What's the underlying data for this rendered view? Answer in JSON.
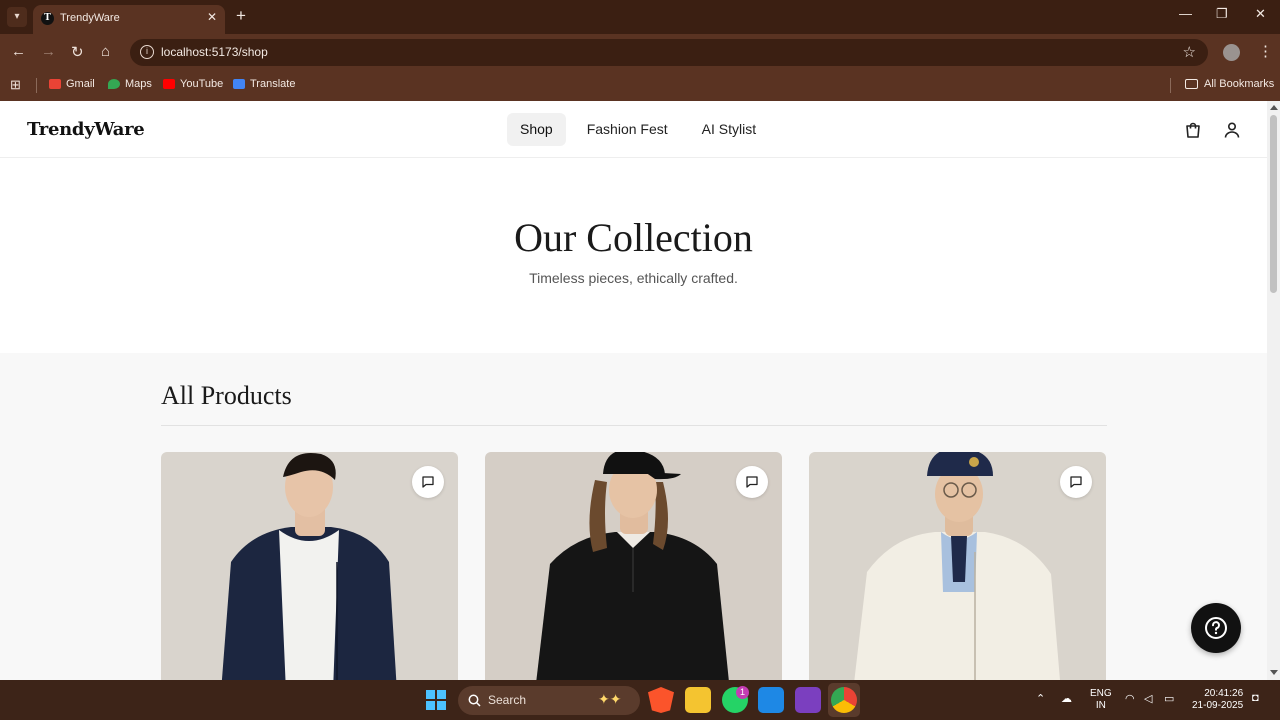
{
  "browser": {
    "tab_title": "TrendyWare",
    "tab_favicon": "T",
    "url": "localhost:5173/shop",
    "bookmarks": [
      {
        "label": "Gmail",
        "color": "#ea4335"
      },
      {
        "label": "Maps",
        "color": "#34a853"
      },
      {
        "label": "YouTube",
        "color": "#ff0000"
      },
      {
        "label": "Translate",
        "color": "#4285f4"
      }
    ],
    "all_bookmarks": "All Bookmarks"
  },
  "site": {
    "logo": "TrendyWare",
    "nav": [
      {
        "label": "Shop",
        "active": true
      },
      {
        "label": "Fashion Fest",
        "active": false
      },
      {
        "label": "AI Stylist",
        "active": false
      }
    ],
    "icons": [
      "shopping-bag-icon",
      "user-icon"
    ]
  },
  "hero": {
    "title": "Our Collection",
    "subtitle": "Timeless pieces, ethically crafted."
  },
  "products": {
    "heading": "All Products",
    "items": [
      {
        "image": "man in navy zip hoodie over white t-shirt",
        "garment_color": "#1c2640"
      },
      {
        "image": "man in black half-zip sweater and black cap",
        "garment_color": "#151515"
      },
      {
        "image": "man in cream zip hoodie with navy cap",
        "garment_color": "#f2eee4"
      }
    ]
  },
  "taskbar": {
    "search_label": "Search",
    "whatsapp_badge": "1",
    "lang_top": "ENG",
    "lang_bottom": "IN",
    "time": "20:41:26",
    "date": "21-09-2025"
  }
}
